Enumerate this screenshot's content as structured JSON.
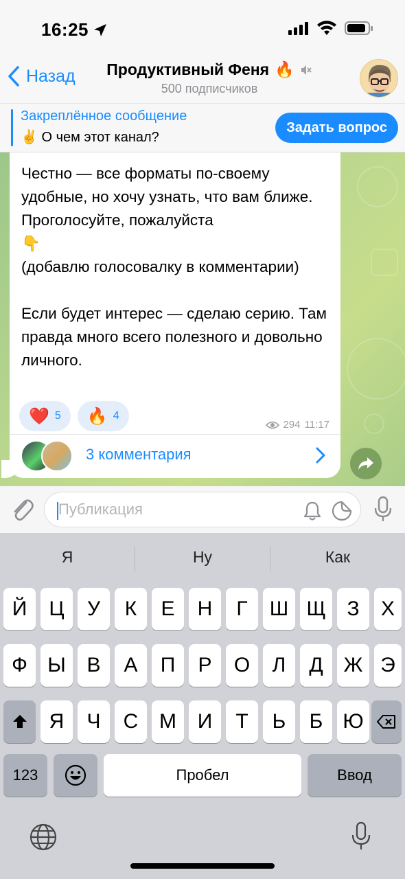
{
  "status_bar": {
    "time": "16:25",
    "icons": [
      "location-arrow-icon",
      "cellular-signal-icon",
      "wifi-icon",
      "battery-icon"
    ]
  },
  "header": {
    "back_label": "Назад",
    "channel_title": "Продуктивный Феня",
    "title_emoji": "🔥",
    "subscribers": "500 подписчиков",
    "muted": true
  },
  "pinned": {
    "title": "Закреплённое сообщение",
    "emoji": "✌️",
    "text": "О чем этот канал?",
    "button_label": "Задать вопрос"
  },
  "message": {
    "paragraph1": "Честно — все форматы по-своему удобные, но хочу узнать, что вам ближе. Проголосуйте, пожалуйста",
    "emoji": "👇",
    "paragraph2": "(добавлю голосовалку в комментарии)",
    "paragraph3": "Если будет интерес — сделаю серию. Там правда много всего полезного и довольно личного.",
    "reactions": [
      {
        "emoji": "❤️",
        "count": "5"
      },
      {
        "emoji": "🔥",
        "count": "4"
      }
    ],
    "views": "294",
    "time": "11:17",
    "comments_label": "3 комментария"
  },
  "composer": {
    "placeholder": "Публикация",
    "value": ""
  },
  "keyboard": {
    "suggestions": [
      "Я",
      "Ну",
      "Как"
    ],
    "row1": [
      "Й",
      "Ц",
      "У",
      "К",
      "Е",
      "Н",
      "Г",
      "Ш",
      "Щ",
      "З",
      "Х"
    ],
    "row2": [
      "Ф",
      "Ы",
      "В",
      "А",
      "П",
      "Р",
      "О",
      "Л",
      "Д",
      "Ж",
      "Э"
    ],
    "row3": [
      "Я",
      "Ч",
      "С",
      "М",
      "И",
      "Т",
      "Ь",
      "Б",
      "Ю"
    ],
    "numbers_label": "123",
    "space_label": "Пробел",
    "return_label": "Ввод"
  },
  "colors": {
    "accent": "#1a8cff",
    "chat_background": "#b8d68e",
    "keyboard_background": "#d0d2d7"
  }
}
